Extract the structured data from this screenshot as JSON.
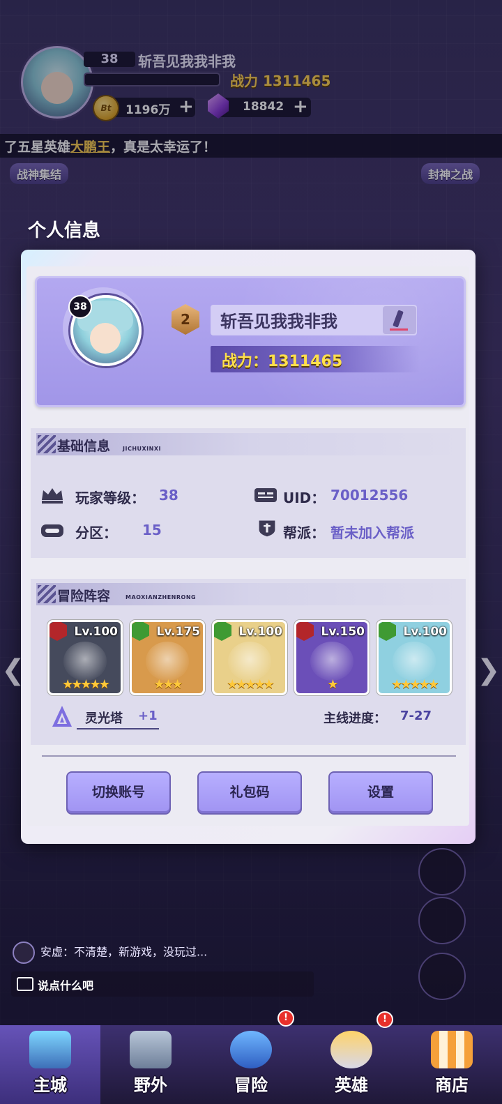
{
  "hud": {
    "level": "38",
    "player_name": "斩吾见我我非我",
    "power_label": "战力 1311465",
    "coin_symbol": "Bt",
    "coins": "1196万",
    "gems": "18842",
    "plus": "+"
  },
  "ticker": {
    "prefix": "了五星英雄",
    "hero": "大鹏王",
    "suffix": "，真是太幸运了！"
  },
  "side": {
    "left_top": "战神集结",
    "right_top": "封神之战"
  },
  "dialog": {
    "title": "个人信息",
    "avatar_level": "38",
    "rank": "2",
    "name": "斩吾见我我非我",
    "power": "战力：1311465",
    "basic": {
      "title": "基础信息",
      "subtitle": "JICHUXINXI",
      "rows": [
        {
          "label": "玩家等级：",
          "value": "38"
        },
        {
          "label": "UID：",
          "value": "70012556"
        },
        {
          "label": "分区：",
          "value": "15"
        },
        {
          "label": "帮派：",
          "value": "暂未加入帮派"
        }
      ]
    },
    "lineup": {
      "title": "冒险阵容",
      "subtitle": "MAOXIANZHENRONG",
      "heroes": [
        {
          "level": "Lv.100",
          "stars": "★★★★★",
          "tag_color": "#b3262a",
          "bg": "#454a5c"
        },
        {
          "level": "Lv.175",
          "stars": "★★★",
          "tag_color": "#3f9a33",
          "bg": "#d89a4c"
        },
        {
          "level": "Lv.100",
          "stars": "★★★★★",
          "tag_color": "#3f9a33",
          "bg": "#e9d08a"
        },
        {
          "level": "Lv.150",
          "stars": "★",
          "tag_color": "#b3262a",
          "bg": "#6b4fb8"
        },
        {
          "level": "Lv.100",
          "stars": "★★★★★",
          "tag_color": "#3f9a33",
          "bg": "#8fd0e0"
        }
      ],
      "tower_label": "灵光塔",
      "tower_value": "+1",
      "progress_label": "主线进度：",
      "progress_value": "7-27"
    },
    "buttons": {
      "switch": "切换账号",
      "gift": "礼包码",
      "settings": "设置"
    }
  },
  "chat": {
    "message": "安虚：不清楚，新游戏，没玩过...",
    "placeholder": "说点什么吧"
  },
  "tabs": [
    {
      "label": "主城",
      "active": true
    },
    {
      "label": "野外"
    },
    {
      "label": "冒险"
    },
    {
      "label": "英雄"
    },
    {
      "label": "商店"
    }
  ],
  "colors": {
    "accent": "#a093f2",
    "power": "#ffe04d",
    "value": "#6a5fc7"
  }
}
